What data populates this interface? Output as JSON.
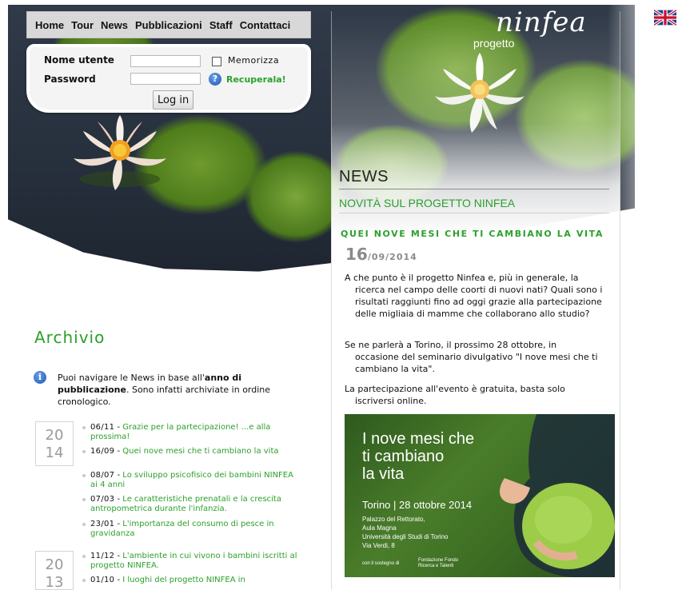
{
  "nav": {
    "items": [
      "Home",
      "Tour",
      "News",
      "Pubblicazioni",
      "Staff",
      "Contattaci"
    ]
  },
  "login": {
    "username_label": "Nome utente",
    "password_label": "Password",
    "remember_label": "Memorizza",
    "recover_label": "Recuperala!",
    "button_label": "Log in"
  },
  "logo": {
    "script": "ninfea",
    "subtitle": "progetto"
  },
  "news": {
    "section_title": "NEWS",
    "subtitle": "NOVITÀ SUL PROGETTO NINFEA",
    "article": {
      "title": "QUEI NOVE MESI CHE TI CAMBIANO LA VITA",
      "day": "16",
      "month_year": "/09/2014",
      "p1_first": "A che punto è il progetto Ninfea e, più in generale, la",
      "p1_rest": "ricerca nel campo delle coorti di nuovi nati? Quali sono i risultati raggiunti fino ad oggi grazie alla partecipazione delle migliaia di mamme che collaborano allo studio?",
      "p2_first": "Se ne parlerà a Torino, il prossimo 28 ottobre, in",
      "p2_rest": "occasione del seminario divulgativo \"I nove mesi che ti cambiano la vita\".",
      "p3_first": "La partecipazione all'evento è gratuita, basta solo",
      "p3_rest": "iscriversi online."
    },
    "promo": {
      "title_line1": "I nove mesi che",
      "title_line2": "ti cambiano",
      "title_line3": "la vita",
      "event": "Torino | 28 ottobre 2014",
      "venue_line1": "Palazzo del Rettorato,",
      "venue_line2": "Aula Magna",
      "venue_line3": "Università degli Studi di Torino",
      "venue_line4": "Via Verdi, 8",
      "sponsor": "con il sostegno di",
      "sponsor_name_line1": "Fondazione Fondo",
      "sponsor_name_line2": "Ricerca e Talenti"
    }
  },
  "archive": {
    "title": "Archivio",
    "intro_pre": "Puoi navigare le News in base all'",
    "intro_bold": "anno di pubblicazione",
    "intro_post": ". Sono infatti archiviate in ordine cronologico.",
    "years": [
      {
        "year_top": "20",
        "year_bottom": "14",
        "items": [
          {
            "date": "06/11",
            "title": "Grazie per la partecipazione! ...e alla prossima!"
          },
          {
            "date": "16/09",
            "title": "Quei nove mesi che ti cambiano la vita"
          },
          {
            "date": "08/07",
            "title": "Lo sviluppo psicofisico dei bambini NINFEA ai 4 anni"
          },
          {
            "date": "07/03",
            "title": "Le caratteristiche prenatali e la crescita antropometrica durante l'infanzia."
          },
          {
            "date": "23/01",
            "title": "L'importanza del consumo di pesce in gravidanza"
          }
        ]
      },
      {
        "year_top": "20",
        "year_bottom": "13",
        "items": [
          {
            "date": "11/12",
            "title": "L'ambiente in cui vivono i bambini iscritti al progetto NINFEA."
          },
          {
            "date": "01/10",
            "title": "I luoghi del progetto NINFEA in"
          }
        ]
      }
    ]
  },
  "colors": {
    "accent_green": "#2ca02c",
    "nav_bg": "#d8d8d8",
    "hero_dark": "#262f3c"
  },
  "icons": [
    "help-icon",
    "info-icon",
    "uk-flag-icon",
    "checkbox-icon"
  ]
}
